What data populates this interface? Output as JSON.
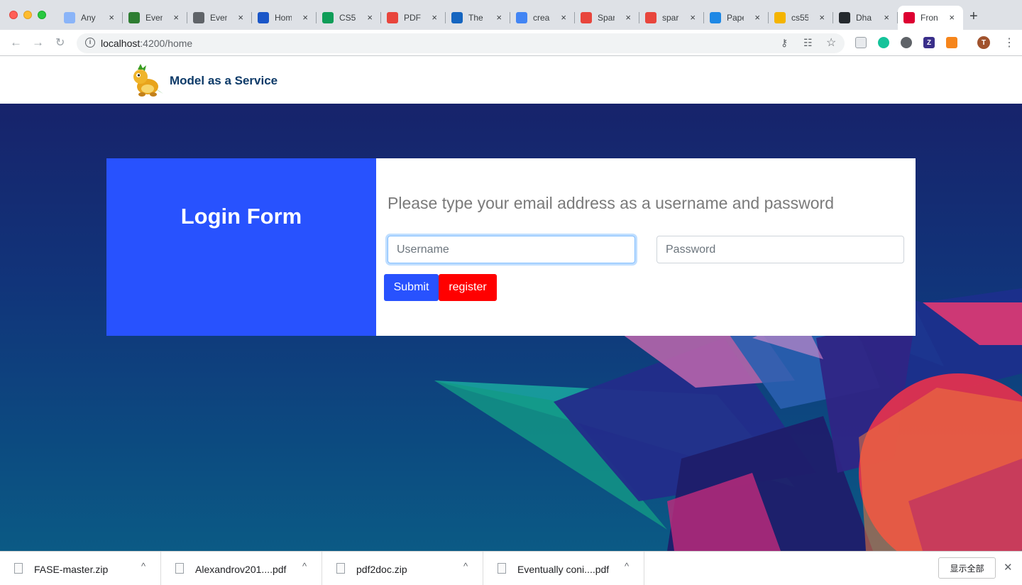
{
  "browser": {
    "tabs": [
      {
        "title": "Any",
        "favicon_color": "#8ab4f8"
      },
      {
        "title": "Even",
        "favicon_color": "#2e7d32"
      },
      {
        "title": "Even",
        "favicon_color": "#5f6368"
      },
      {
        "title": "Hom",
        "favicon_color": "#1a56c8"
      },
      {
        "title": "CS5",
        "favicon_color": "#0f9d58"
      },
      {
        "title": "PDF",
        "favicon_color": "#e8453c"
      },
      {
        "title": "The",
        "favicon_color": "#1565c0"
      },
      {
        "title": "crea",
        "favicon_color": "#4285f4"
      },
      {
        "title": "Spar",
        "favicon_color": "#e8453c"
      },
      {
        "title": "spar",
        "favicon_color": "#e8453c"
      },
      {
        "title": "Pape",
        "favicon_color": "#1e88e5"
      },
      {
        "title": "cs55",
        "favicon_color": "#f4b400"
      },
      {
        "title": "Dha",
        "favicon_color": "#24292e"
      },
      {
        "title": "Fron",
        "favicon_color": "#dd0031"
      }
    ],
    "active_tab_index": 13,
    "url_host": "localhost",
    "url_path": ":4200/home",
    "new_tab_label": "+",
    "close_glyph": "×"
  },
  "site": {
    "brand": "Model as a Service"
  },
  "login": {
    "title": "Login Form",
    "prompt": "Please type your email address as a username and password",
    "username_placeholder": "Username",
    "password_placeholder": "Password",
    "submit_label": "Submit",
    "register_label": "register"
  },
  "downloads": {
    "items": [
      {
        "name": "FASE-master.zip"
      },
      {
        "name": "Alexandrov201....pdf"
      },
      {
        "name": "pdf2doc.zip"
      },
      {
        "name": "Eventually coni....pdf"
      }
    ],
    "show_all_label": "显示全部",
    "chevron": "^",
    "close_glyph": "✕"
  },
  "colors": {
    "primary": "#2852fe",
    "register": "#ff0000",
    "brand_text": "#0d3a68"
  }
}
